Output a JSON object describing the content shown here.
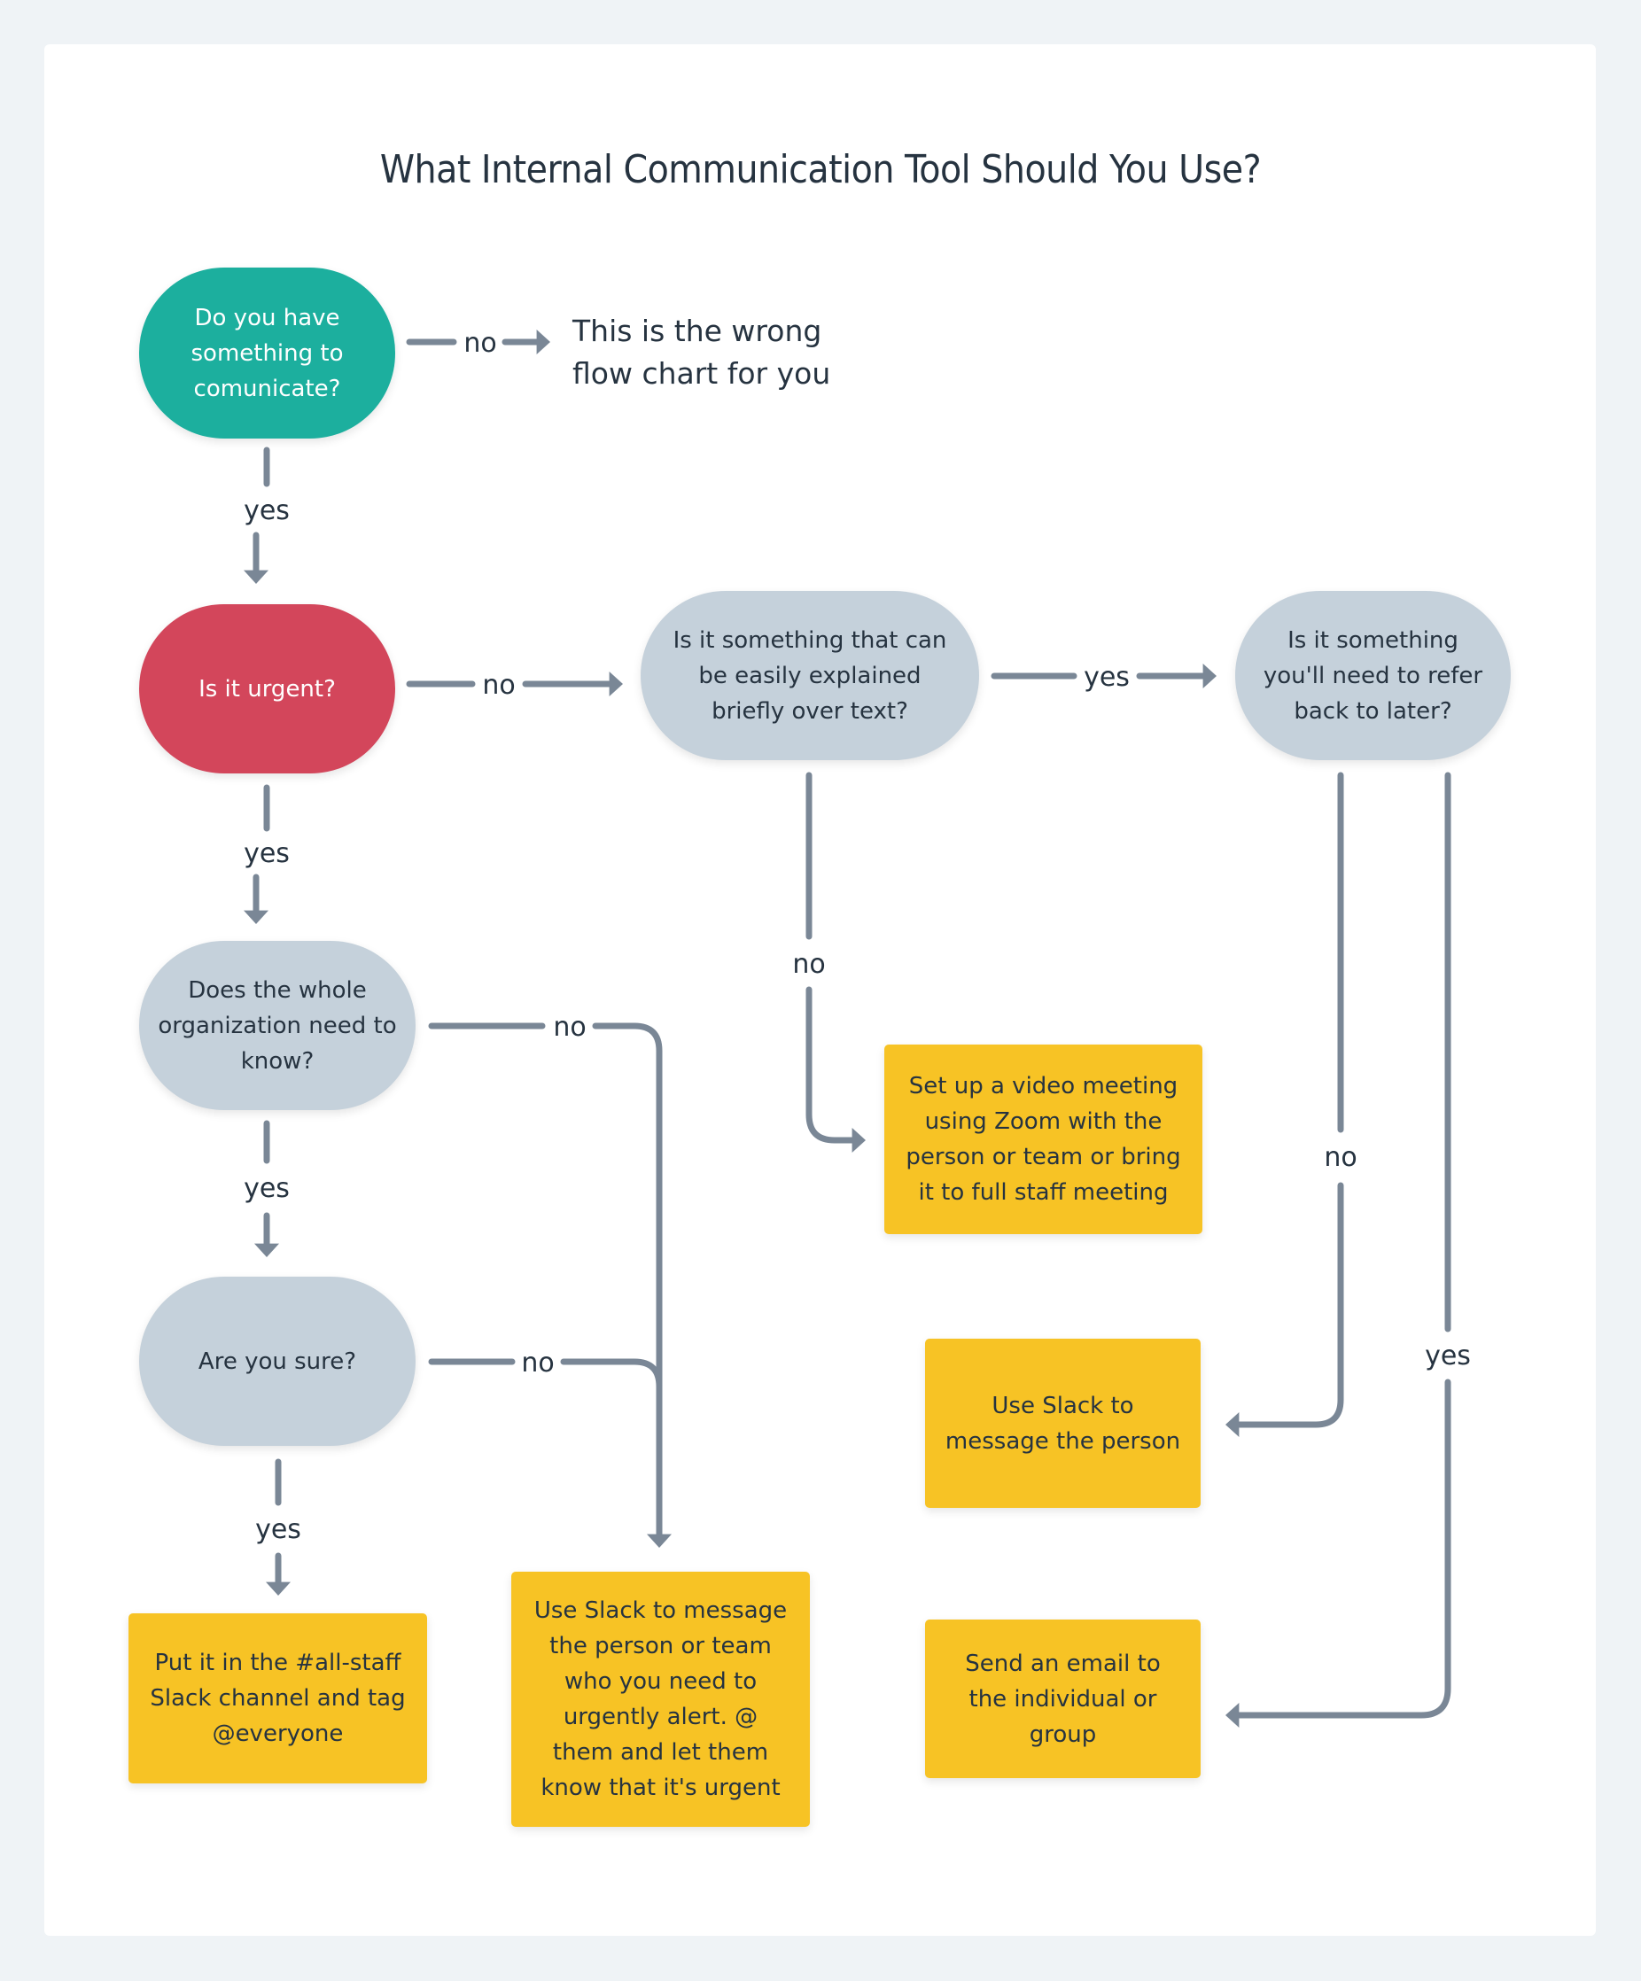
{
  "title": "What Internal Communication Tool Should You Use?",
  "colors": {
    "background": "#EFF3F6",
    "card": "#FFFFFF",
    "start_node": "#1CAF9E",
    "urgent_node": "#D3465B",
    "question_node": "#C5D1DB",
    "outcome_box": "#F7C325",
    "connector": "#7A8796",
    "text": "#263340"
  },
  "nodes": {
    "start": "Do you have\nsomething to\ncomunicate?",
    "wrong_chart": "This is the wrong\nflow chart for you",
    "urgent": "Is it urgent?",
    "text_explain": "Is it something that can\nbe easily explained\nbriefly over text?",
    "refer_back": "Is it something\nyou'll need to refer\nback to later?",
    "whole_org": "Does the whole\norganization need to\nknow?",
    "are_you_sure": "Are you sure?",
    "all_staff": "Put it in the #all-staff\nSlack channel and tag\n@everyone",
    "slack_urgent": "Use Slack to message\nthe person or team\nwho you need to\nurgently alert. @\nthem and let them\nknow that it's urgent",
    "video_meeting": "Set up a video meeting\nusing Zoom with the\nperson or team or bring\nit to full staff meeting",
    "slack_person": "Use Slack to\nmessage the person",
    "email": "Send an email to\nthe individual or\ngroup"
  },
  "edges": [
    {
      "from": "start",
      "to": "wrong_chart",
      "label": "no"
    },
    {
      "from": "start",
      "to": "urgent",
      "label": "yes"
    },
    {
      "from": "urgent",
      "to": "text_explain",
      "label": "no"
    },
    {
      "from": "urgent",
      "to": "whole_org",
      "label": "yes"
    },
    {
      "from": "text_explain",
      "to": "refer_back",
      "label": "yes"
    },
    {
      "from": "text_explain",
      "to": "video_meeting",
      "label": "no"
    },
    {
      "from": "whole_org",
      "to": "slack_urgent",
      "label": "no"
    },
    {
      "from": "whole_org",
      "to": "are_you_sure",
      "label": "yes"
    },
    {
      "from": "are_you_sure",
      "to": "slack_urgent",
      "label": "no"
    },
    {
      "from": "are_you_sure",
      "to": "all_staff",
      "label": "yes"
    },
    {
      "from": "refer_back",
      "to": "slack_person",
      "label": "no"
    },
    {
      "from": "refer_back",
      "to": "email",
      "label": "yes"
    }
  ]
}
